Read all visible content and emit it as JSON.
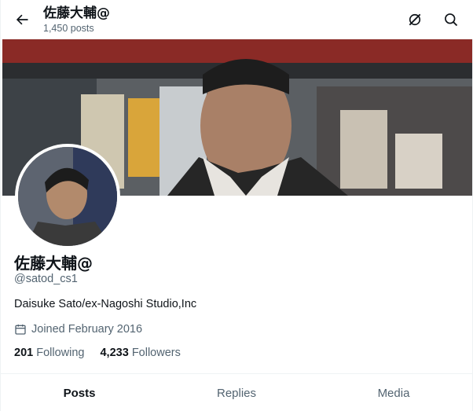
{
  "header": {
    "title": "佐藤大輔@",
    "posts_count": "1,450 posts",
    "back_icon": "arrow-left-icon",
    "grok_icon": "grok-icon",
    "search_icon": "search-icon"
  },
  "profile": {
    "display_name": "佐藤大輔@",
    "handle": "@satod_cs1",
    "bio": "Daisuke Sato/ex-Nagoshi Studio,Inc",
    "joined": "Joined February 2016",
    "following_count": "201",
    "following_label": "Following",
    "followers_count": "4,233",
    "followers_label": "Followers"
  },
  "tabs": [
    {
      "label": "Posts",
      "active": true
    },
    {
      "label": "Replies",
      "active": false
    },
    {
      "label": "Media",
      "active": false
    }
  ],
  "colors": {
    "text_primary": "#0f1419",
    "text_secondary": "#536471",
    "border": "#eff3f4"
  }
}
